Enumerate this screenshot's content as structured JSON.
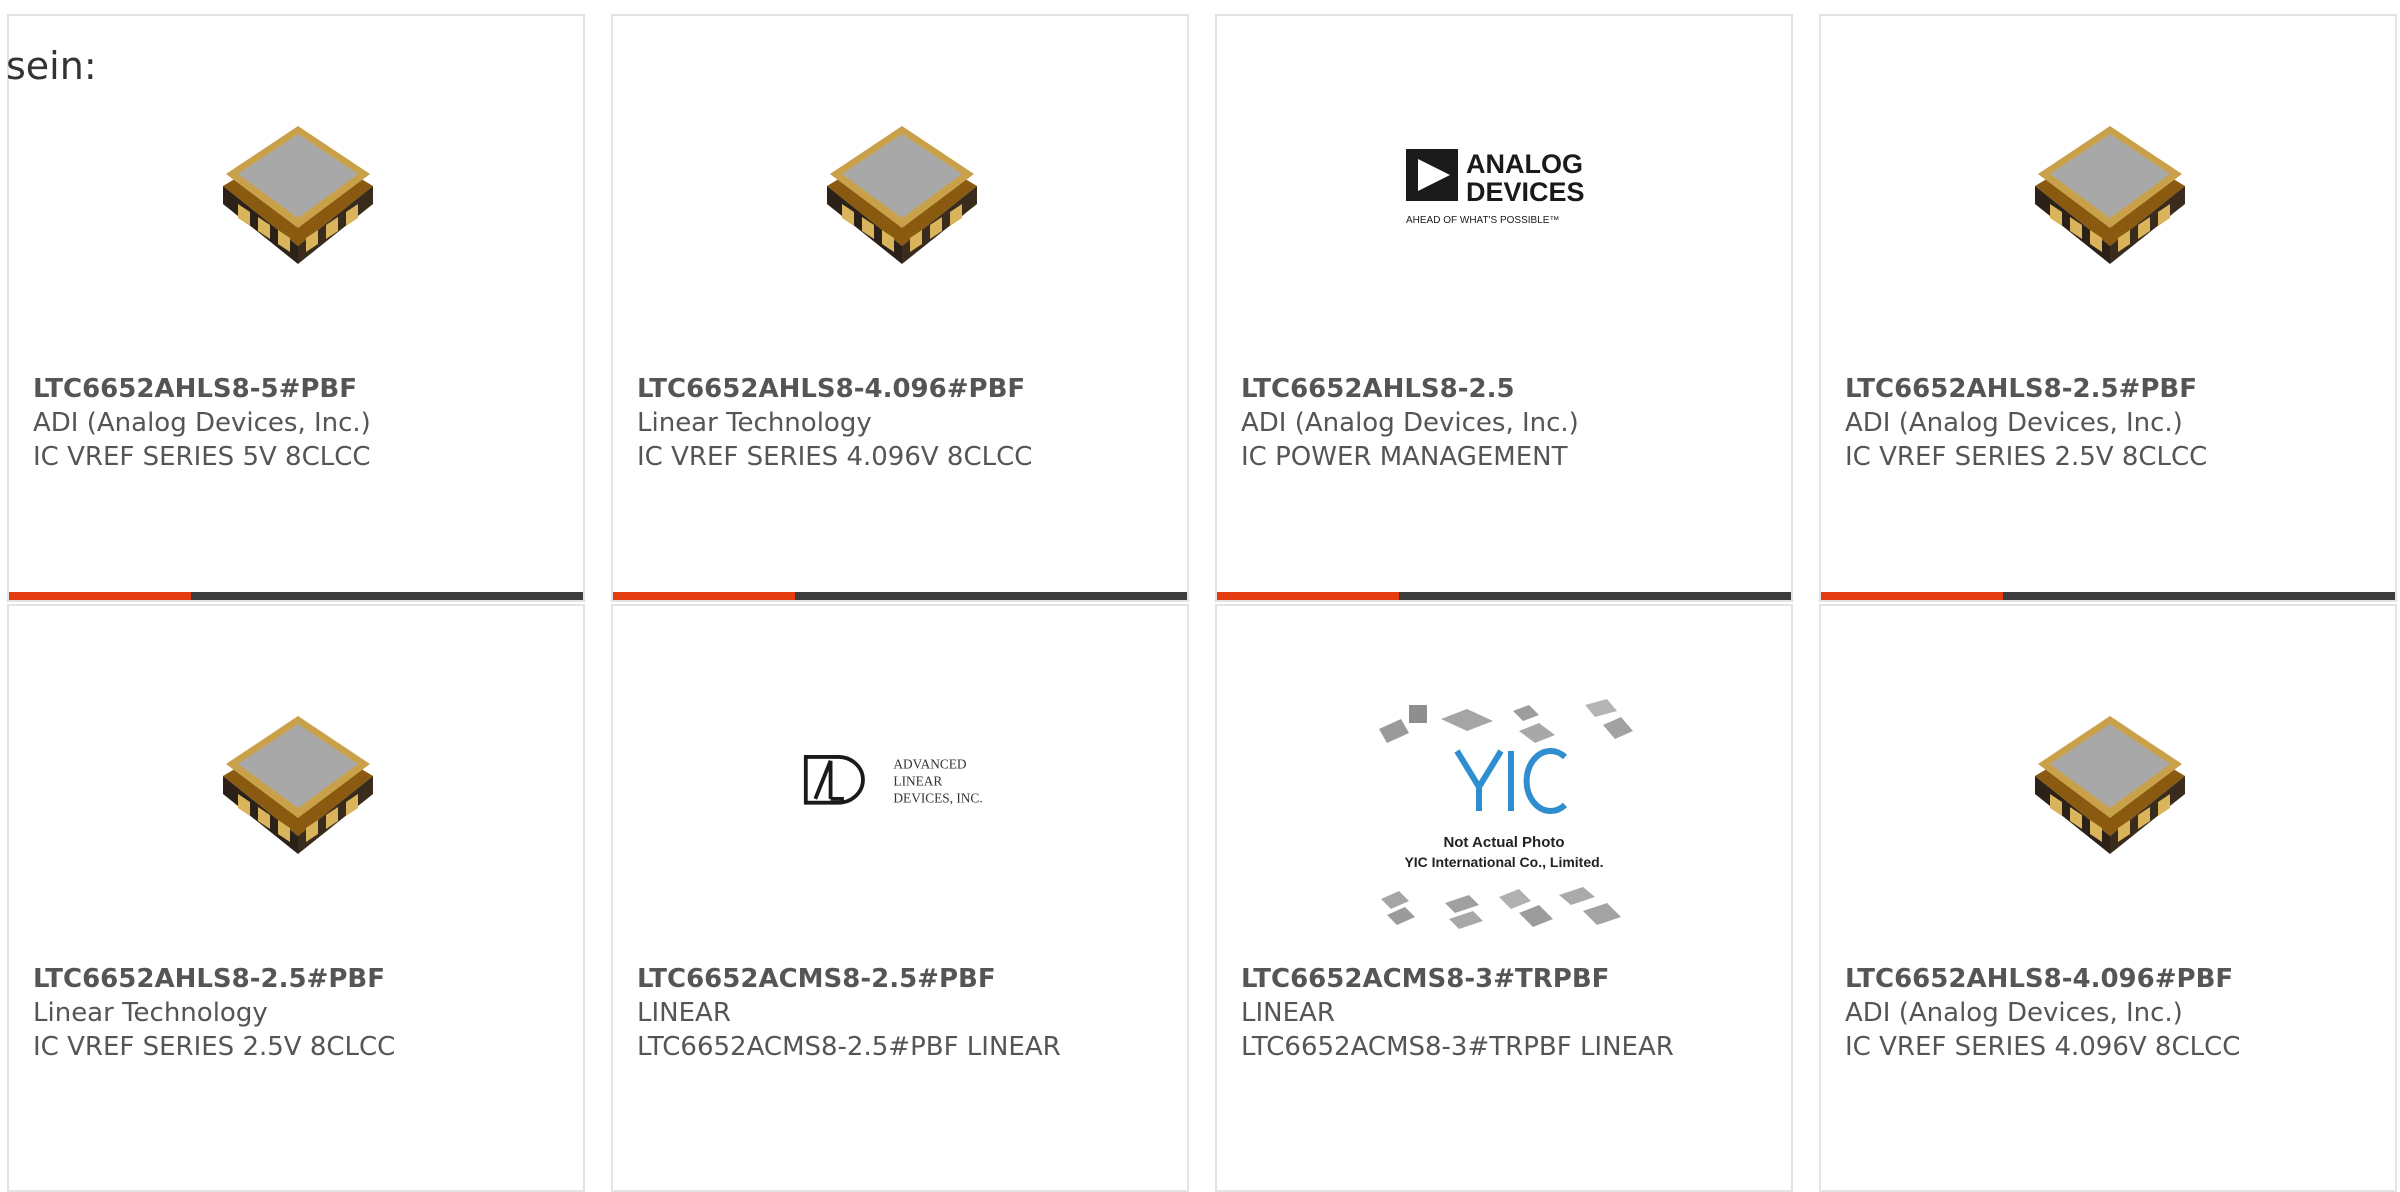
{
  "intro_text": "sein:",
  "colors": {
    "accent": "#e23c10",
    "bar": "#3c3c3c",
    "border": "#e3e3e3",
    "text": "#555555"
  },
  "logos": {
    "adi": {
      "line1": "ANALOG",
      "line2": "DEVICES",
      "tagline": "AHEAD OF WHAT'S POSSIBLE™"
    },
    "ald": {
      "line1": "ADVANCED",
      "line2": "LINEAR",
      "line3": "DEVICES, INC."
    },
    "yic": {
      "brand": "YIC",
      "note1": "Not Actual Photo",
      "note2": "YIC International Co., Limited."
    }
  },
  "products": [
    {
      "part": "LTC6652AHLS8-5#PBF",
      "maker": "ADI (Analog Devices, Inc.)",
      "desc": "IC VREF SERIES 5V 8CLCC",
      "image": "chip-icon"
    },
    {
      "part": "LTC6652AHLS8-4.096#PBF",
      "maker": "Linear Technology",
      "desc": "IC VREF SERIES 4.096V 8CLCC",
      "image": "chip-icon"
    },
    {
      "part": "LTC6652AHLS8-2.5",
      "maker": "ADI (Analog Devices, Inc.)",
      "desc": "IC POWER MANAGEMENT",
      "image": "analog-devices-logo"
    },
    {
      "part": "LTC6652AHLS8-2.5#PBF",
      "maker": "ADI (Analog Devices, Inc.)",
      "desc": "IC VREF SERIES 2.5V 8CLCC",
      "image": "chip-icon"
    },
    {
      "part": "LTC6652AHLS8-2.5#PBF",
      "maker": "Linear Technology",
      "desc": "IC VREF SERIES 2.5V 8CLCC",
      "image": "chip-icon"
    },
    {
      "part": "LTC6652ACMS8-2.5#PBF",
      "maker": "LINEAR",
      "desc": "LTC6652ACMS8-2.5#PBF LINEAR",
      "image": "advanced-linear-devices-logo"
    },
    {
      "part": "LTC6652ACMS8-3#TRPBF",
      "maker": "LINEAR",
      "desc": "LTC6652ACMS8-3#TRPBF LINEAR",
      "image": "yic-placeholder-image"
    },
    {
      "part": "LTC6652AHLS8-4.096#PBF",
      "maker": "ADI (Analog Devices, Inc.)",
      "desc": "IC VREF SERIES 4.096V 8CLCC",
      "image": "chip-icon"
    }
  ]
}
